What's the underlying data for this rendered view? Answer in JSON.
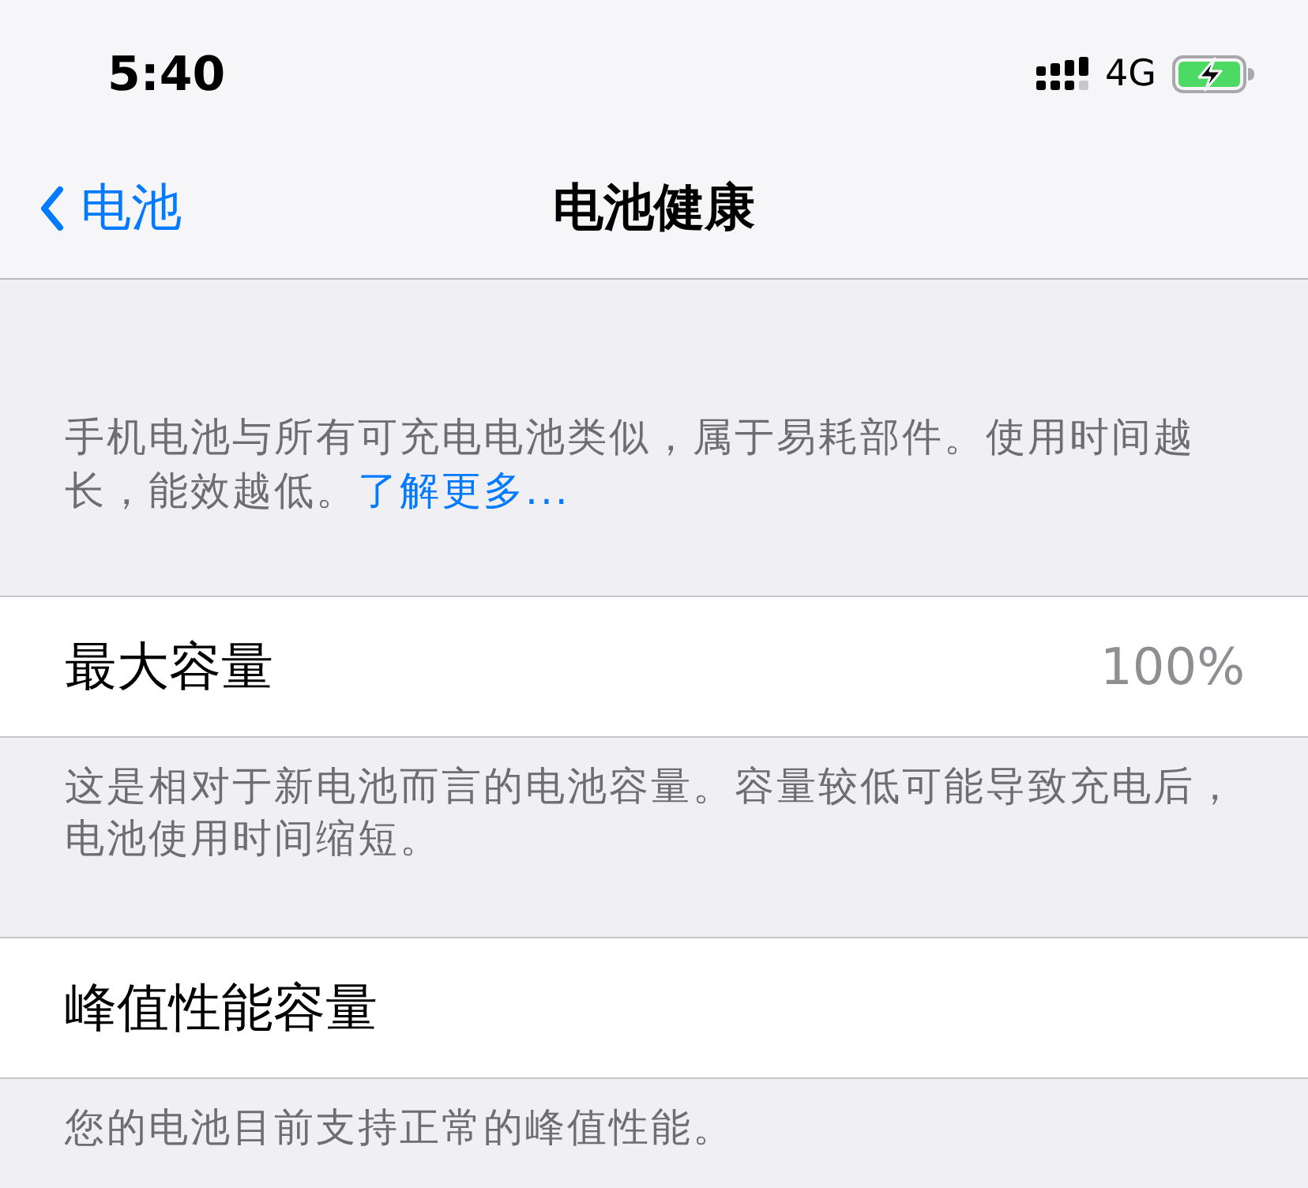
{
  "status_bar": {
    "time": "5:40",
    "network": "4G"
  },
  "nav_bar": {
    "back_label": "电池",
    "title": "电池健康"
  },
  "intro": {
    "text": "手机电池与所有可充电电池类似，属于易耗部件。使用时间越长，能效越低。",
    "link": "了解更多..."
  },
  "sections": [
    {
      "label": "最大容量",
      "value": "100%",
      "footer": "这是相对于新电池而言的电池容量。容量较低可能导致充电后，电池使用时间缩短。"
    },
    {
      "label": "峰值性能容量",
      "footer": "您的电池目前支持正常的峰值性能。"
    }
  ]
}
